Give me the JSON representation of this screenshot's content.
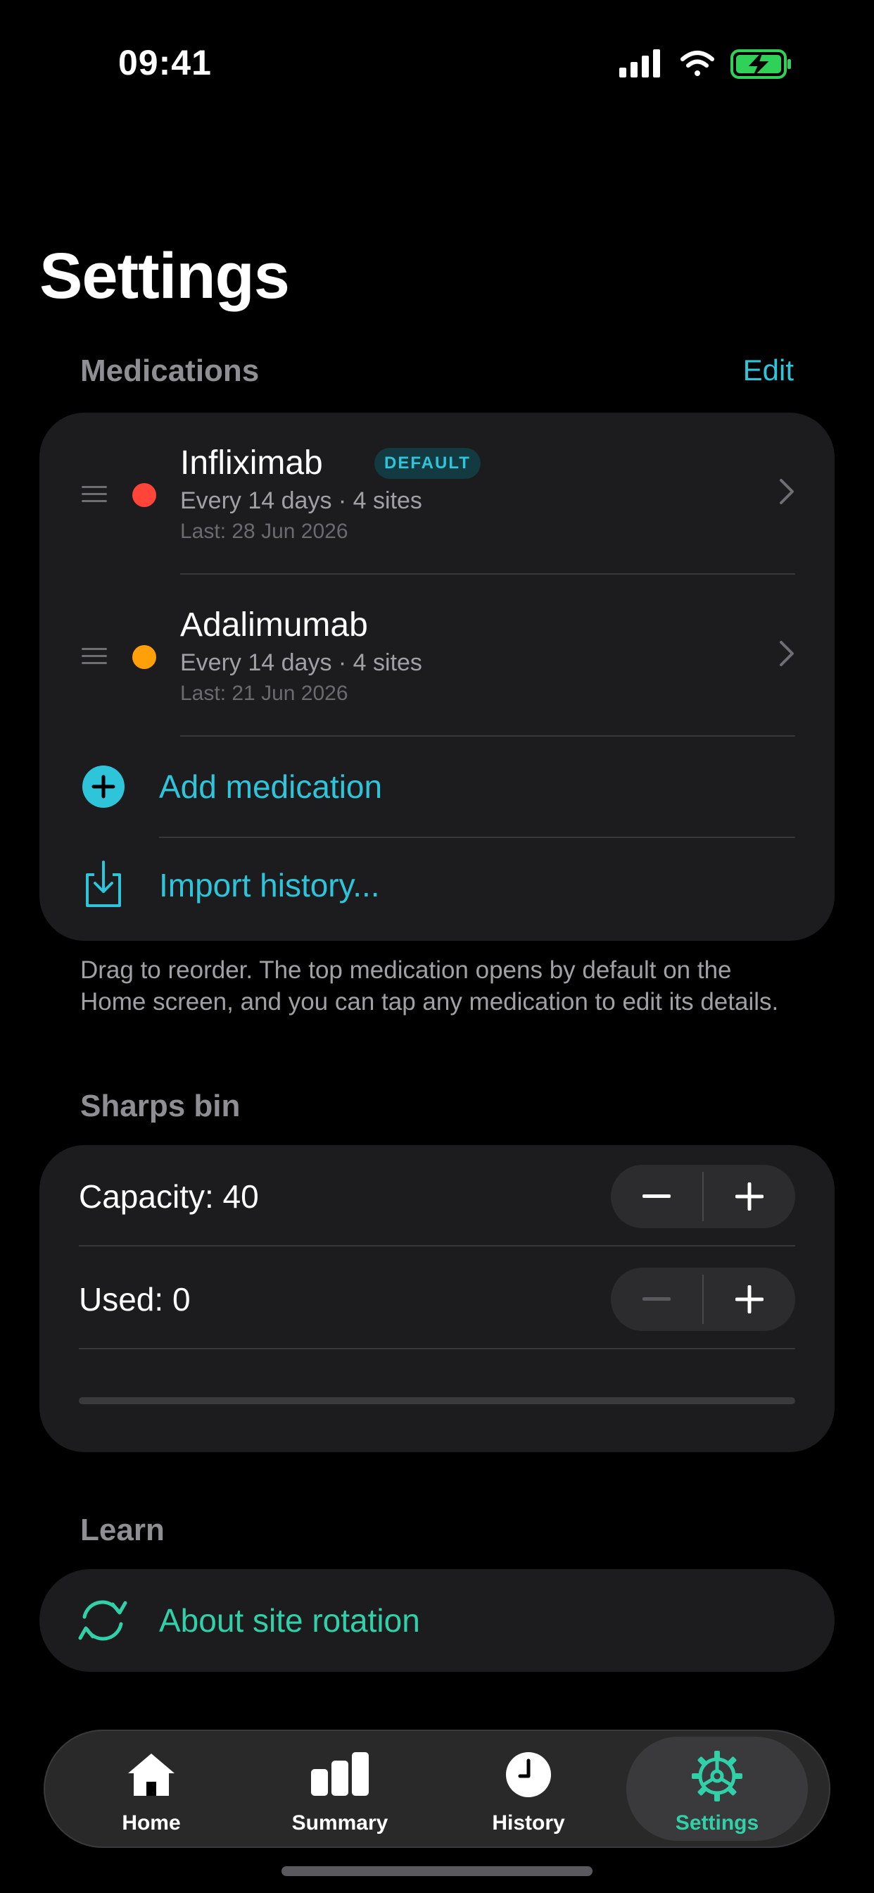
{
  "status_bar": {
    "time": "09:41"
  },
  "page_title": "Settings",
  "medications": {
    "header": "Medications",
    "edit_label": "Edit",
    "items": [
      {
        "name": "Infliximab",
        "badge": "DEFAULT",
        "schedule": "Every 14 days · 4 sites",
        "last": "Last: 28 Jun 2026",
        "color": "#ff453a"
      },
      {
        "name": "Adalimumab",
        "badge": "",
        "schedule": "Every 14 days · 4 sites",
        "last": "Last: 21 Jun 2026",
        "color": "#ff9f0a"
      }
    ],
    "add_label": "Add medication",
    "import_label": "Import history...",
    "footnote": "Drag to reorder. The top medication opens by default on the Home screen, and you can tap any medication to edit its details."
  },
  "sharps_bin": {
    "header": "Sharps bin",
    "capacity_label": "Capacity: 40",
    "used_label": "Used: 0",
    "capacity": 40,
    "used": 0
  },
  "learn": {
    "header": "Learn",
    "about_label": "About site rotation"
  },
  "tab_bar": {
    "tabs": [
      {
        "label": "Home",
        "icon": "house-icon"
      },
      {
        "label": "Summary",
        "icon": "bar-chart-icon"
      },
      {
        "label": "History",
        "icon": "clock-icon"
      },
      {
        "label": "Settings",
        "icon": "gear-icon"
      }
    ],
    "selected": "Settings"
  },
  "colors": {
    "accent": "#2ec4d9",
    "learn_accent": "#30d1a8",
    "background": "#000000",
    "card": "#1c1c1e"
  }
}
